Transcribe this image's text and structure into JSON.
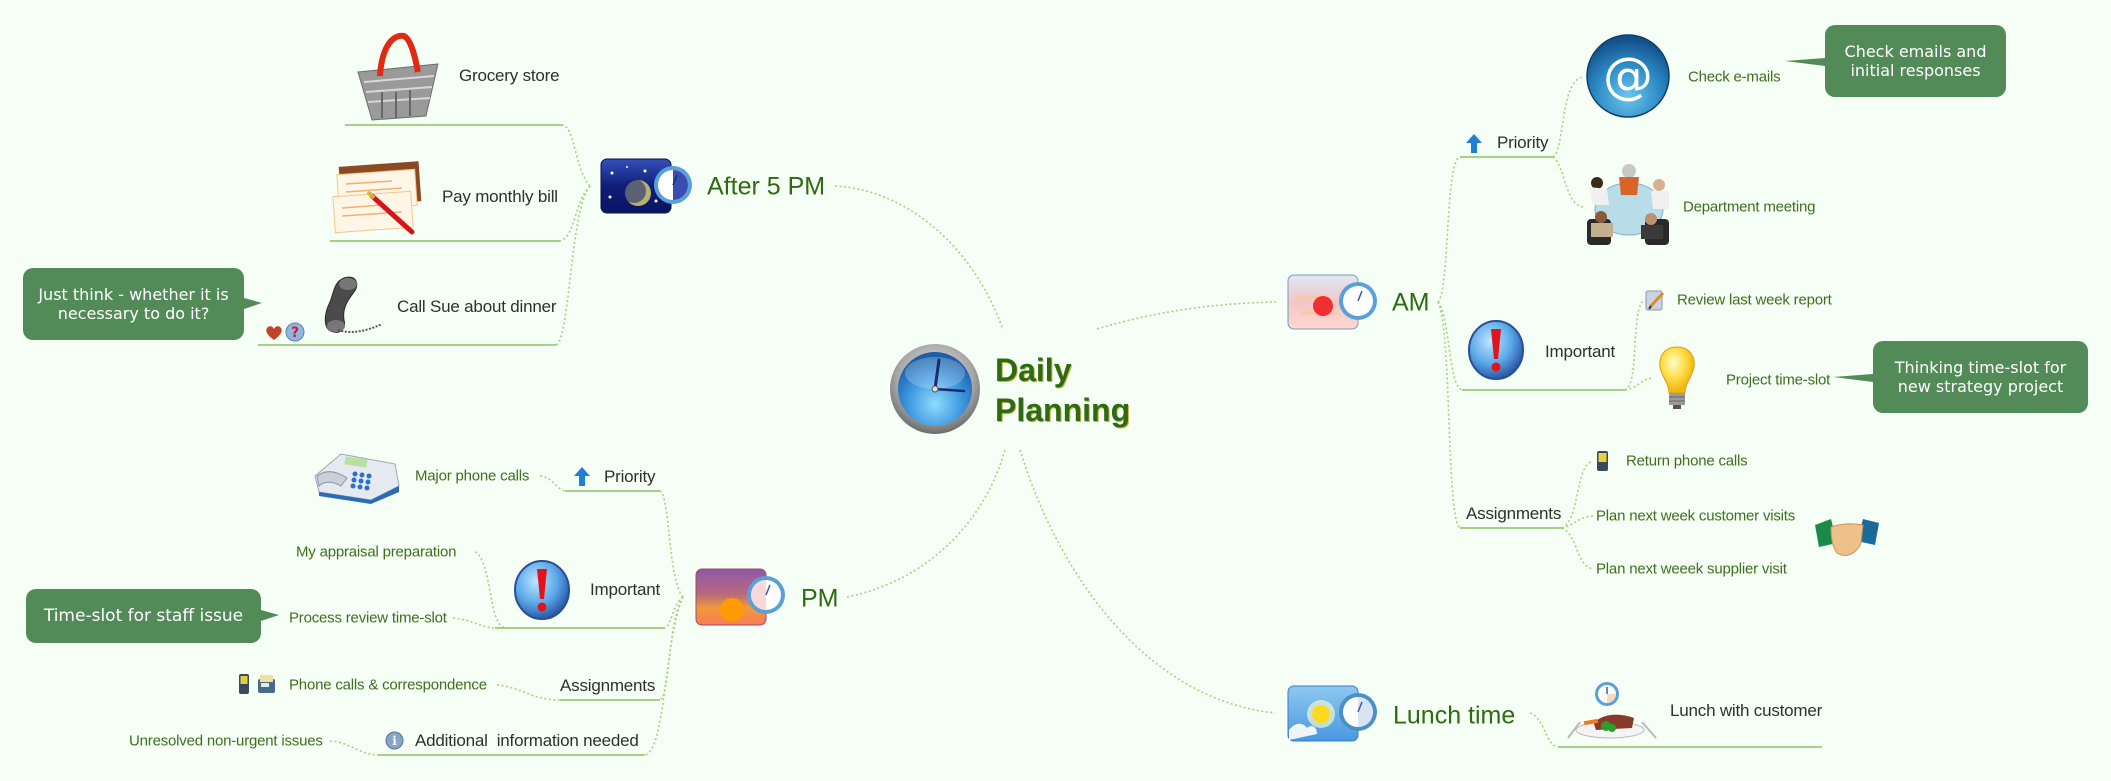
{
  "title": {
    "line1": "Daily",
    "line2": "Planning"
  },
  "colors": {
    "background": "#f5fff5",
    "branch_label": "#2e6a12",
    "leaf_label": "#3f6e1e",
    "sub_label": "#2f2f2f",
    "callout_bg": "#528b58",
    "connector": "#a7d07f",
    "underline": "#8fbf66"
  },
  "after5pm": {
    "label": "After 5 PM",
    "icon": "night-clock-icon",
    "items": [
      {
        "label": "Grocery store",
        "icon": "shopping-basket-icon"
      },
      {
        "label": "Pay monthly bill",
        "icon": "bill-pen-icon"
      },
      {
        "label": "Call Sue about dinner",
        "icon": "telephone-receiver-icon",
        "markers": [
          "heart-icon",
          "question-icon"
        ],
        "callout": "Just think - whether it is necessary to do it?"
      }
    ]
  },
  "pm": {
    "label": "PM",
    "icon": "sunset-clock-icon",
    "groups": [
      {
        "label": "Priority",
        "icon": "priority-arrow-icon",
        "items": [
          {
            "label": "Major phone calls",
            "icon": "desk-phone-icon"
          }
        ]
      },
      {
        "label": "Important",
        "icon": "exclamation-icon",
        "items": [
          {
            "label": "My appraisal preparation"
          },
          {
            "label": "Process review time-slot",
            "callout": "Time-slot for staff issue"
          }
        ]
      },
      {
        "label": "Assignments",
        "items": [
          {
            "label": "Phone calls & correspondence",
            "icons": [
              "mobile-phone-icon",
              "fax-icon"
            ]
          }
        ]
      },
      {
        "label": "Additional  information needed",
        "icon": "info-icon",
        "items": [
          {
            "label": "Unresolved non-urgent issues"
          }
        ]
      }
    ]
  },
  "am": {
    "label": "AM",
    "icon": "sunrise-clock-icon",
    "groups": [
      {
        "label": "Priority",
        "icon": "priority-arrow-icon",
        "items": [
          {
            "label": "Check e-mails",
            "icon": "email-at-icon",
            "callout": "Check emails and initial responses"
          },
          {
            "label": "Department meeting",
            "icon": "meeting-table-icon"
          }
        ]
      },
      {
        "label": "Important",
        "icon": "exclamation-icon",
        "items": [
          {
            "label": "Review last week report",
            "icon": "notepad-pencil-icon"
          },
          {
            "label": "Project time-slot",
            "icon": "lightbulb-icon",
            "callout": "Thinking time-slot for new strategy project"
          }
        ]
      },
      {
        "label": "Assignments",
        "items": [
          {
            "label": "Return phone calls",
            "icon": "mobile-phone-icon"
          },
          {
            "label": "Plan next week customer visits",
            "icon": "handshake-icon"
          },
          {
            "label": "Plan next weeek supplier visit"
          }
        ]
      }
    ]
  },
  "lunch": {
    "label": "Lunch time",
    "icon": "daytime-clock-icon",
    "items": [
      {
        "label": "Lunch with customer",
        "icon": "meal-plate-clock-icon"
      }
    ]
  }
}
